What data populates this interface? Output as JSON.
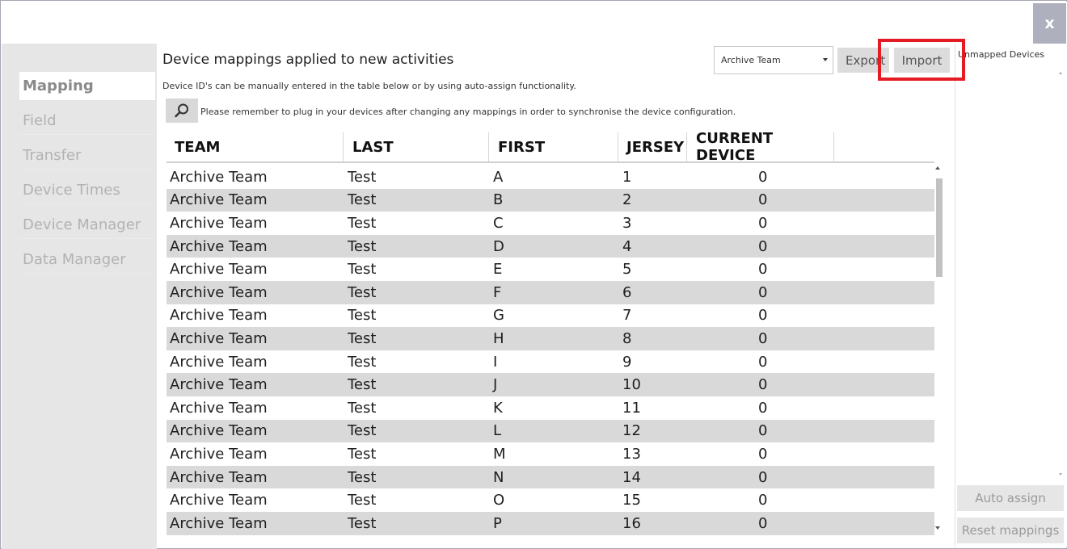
{
  "window": {
    "close_label": "x"
  },
  "sidebar": {
    "items": [
      {
        "label": "Mapping",
        "active": true
      },
      {
        "label": "Field",
        "active": false
      },
      {
        "label": "Transfer",
        "active": false
      },
      {
        "label": "Device Times",
        "active": false
      },
      {
        "label": "Device Manager",
        "active": false
      },
      {
        "label": "Data Manager",
        "active": false
      }
    ]
  },
  "main": {
    "title": "Device mappings applied to new activities",
    "instructions": "Device ID's can be manually entered in the table below or by using auto-assign functionality.",
    "reminder": "Please remember to plug in your devices after changing any mappings in order to synchronise the device configuration.",
    "team_select_value": "Archive Team",
    "export_label": "Export",
    "import_label": "Import",
    "search_icon": "search-icon"
  },
  "table": {
    "columns": [
      "TEAM",
      "LAST",
      "FIRST",
      "JERSEY",
      "CURRENT DEVICE"
    ],
    "rows": [
      [
        "Archive Team",
        "Test",
        "A",
        "1",
        "0"
      ],
      [
        "Archive Team",
        "Test",
        "B",
        "2",
        "0"
      ],
      [
        "Archive Team",
        "Test",
        "C",
        "3",
        "0"
      ],
      [
        "Archive Team",
        "Test",
        "D",
        "4",
        "0"
      ],
      [
        "Archive Team",
        "Test",
        "E",
        "5",
        "0"
      ],
      [
        "Archive Team",
        "Test",
        "F",
        "6",
        "0"
      ],
      [
        "Archive Team",
        "Test",
        "G",
        "7",
        "0"
      ],
      [
        "Archive Team",
        "Test",
        "H",
        "8",
        "0"
      ],
      [
        "Archive Team",
        "Test",
        "I",
        "9",
        "0"
      ],
      [
        "Archive Team",
        "Test",
        "J",
        "10",
        "0"
      ],
      [
        "Archive Team",
        "Test",
        "K",
        "11",
        "0"
      ],
      [
        "Archive Team",
        "Test",
        "L",
        "12",
        "0"
      ],
      [
        "Archive Team",
        "Test",
        "M",
        "13",
        "0"
      ],
      [
        "Archive Team",
        "Test",
        "N",
        "14",
        "0"
      ],
      [
        "Archive Team",
        "Test",
        "O",
        "15",
        "0"
      ],
      [
        "Archive Team",
        "Test",
        "P",
        "16",
        "0"
      ]
    ]
  },
  "right_panel": {
    "label": "Unmapped Devices",
    "auto_assign_label": "Auto assign",
    "reset_label": "Reset mappings"
  },
  "colors": {
    "highlight": "#e51b24",
    "row_alt": "#d9d9d9",
    "sidebar_bg": "#e6e6e6",
    "close_bg": "#aeb0bd"
  }
}
